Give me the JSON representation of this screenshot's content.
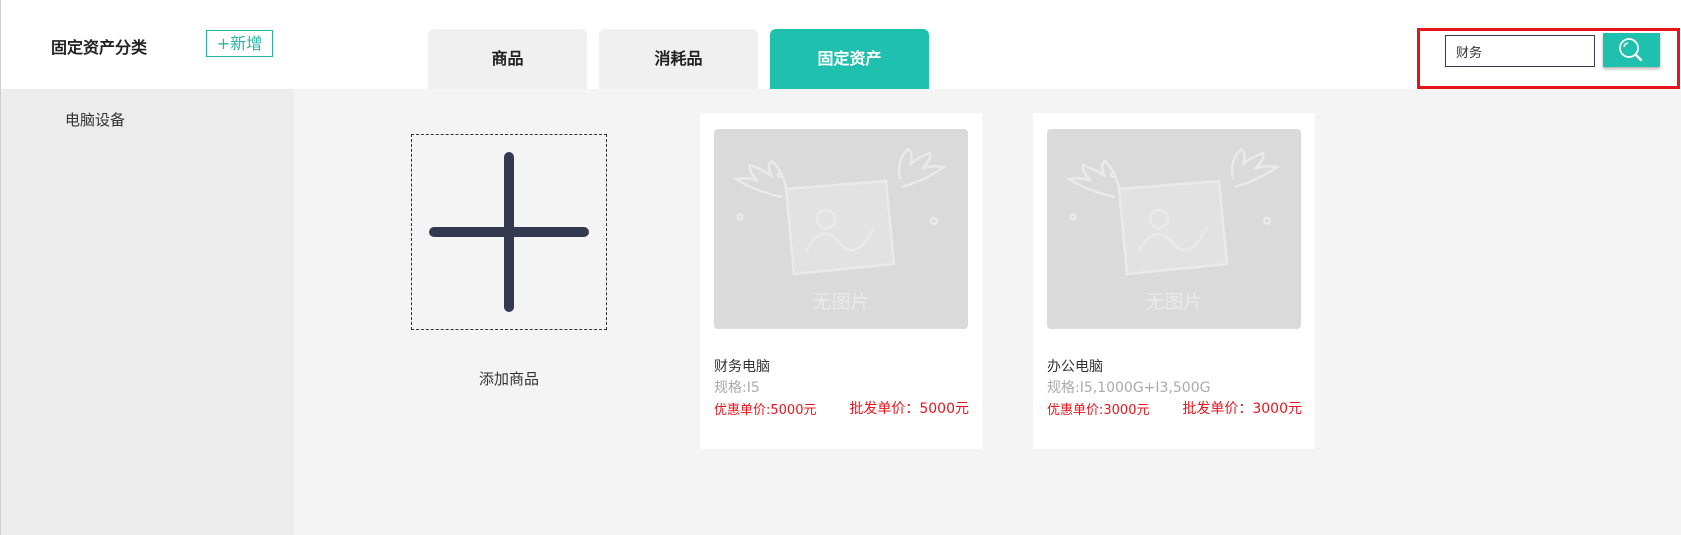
{
  "sidebar": {
    "title": "固定资产分类",
    "add_button": "+新增",
    "items": [
      {
        "label": "电脑设备"
      }
    ]
  },
  "tabs": [
    {
      "label": "商品",
      "active": false
    },
    {
      "label": "消耗品",
      "active": false
    },
    {
      "label": "固定资产",
      "active": true
    }
  ],
  "search": {
    "value": "财务",
    "button_icon": "search-icon"
  },
  "add_product": {
    "label": "添加商品",
    "icon": "plus-icon"
  },
  "products": [
    {
      "no_image_text": "无图片",
      "name": "财务电脑",
      "spec": "规格:I5",
      "discount_price": "优惠单价:5000元",
      "wholesale_price": "批发单价：5000元"
    },
    {
      "no_image_text": "无图片",
      "name": "办公电脑",
      "spec": "规格:I5,1000G+I3,500G",
      "discount_price": "优惠单价:3000元",
      "wholesale_price": "批发单价：3000元"
    }
  ],
  "colors": {
    "accent": "#20c0ae",
    "price_red": "#e8141c",
    "highlight_red": "#e8141c",
    "sidebar_bg": "#ececec",
    "page_bg": "#f4f4f4"
  }
}
